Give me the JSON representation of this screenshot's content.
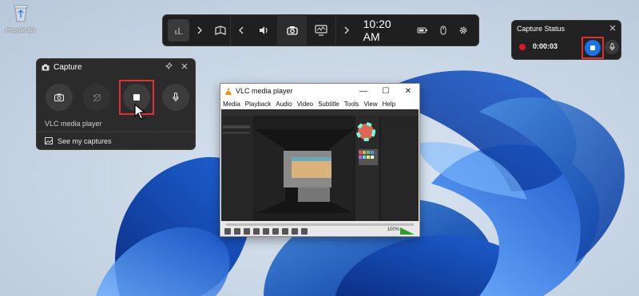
{
  "desktop": {
    "recycle_bin_label": "Recycle Bin"
  },
  "gamebar": {
    "time": "10:20 AM",
    "icons": [
      "home-icon",
      "chevron-right-icon",
      "widget-store-icon",
      "chevron-left-icon",
      "audio-icon",
      "capture-camera-icon",
      "performance-icon",
      "chevron-right-icon",
      "battery-icon",
      "mouse-icon",
      "settings-gear-icon"
    ]
  },
  "capture_widget": {
    "title": "Capture",
    "app_name": "VLC media player",
    "see_captures": "See my captures",
    "buttons": [
      "screenshot-camera-icon",
      "last-30s-icon",
      "stop-recording-icon",
      "microphone-icon"
    ]
  },
  "capture_status": {
    "title": "Capture Status",
    "elapsed": "0:00:03"
  },
  "vlc": {
    "title": "VLC media player",
    "menu": [
      "Media",
      "Playback",
      "Audio",
      "Video",
      "Subtitle",
      "Tools",
      "View",
      "Help"
    ],
    "volume_label": "100%"
  },
  "colors": {
    "accent_blue": "#1a73e8",
    "record_red": "#e81123",
    "highlight_red": "#e03030",
    "panel_dark": "#2b2b2b"
  }
}
